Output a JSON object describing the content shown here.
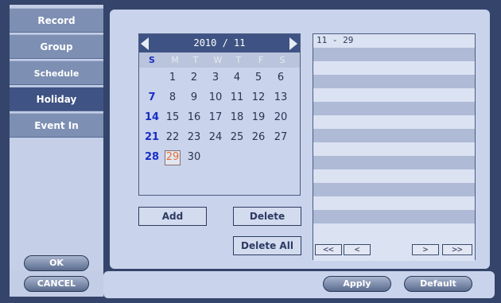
{
  "sidebar": {
    "items": [
      {
        "label": "Record"
      },
      {
        "label": "Group"
      },
      {
        "label": "Schedule"
      },
      {
        "label": "Holiday"
      },
      {
        "label": "Event In"
      }
    ],
    "active_index": 3
  },
  "buttons": {
    "ok": "OK",
    "cancel": "CANCEL",
    "apply": "Apply",
    "default": "Default",
    "add": "Add",
    "delete": "Delete",
    "delete_all": "Delete All"
  },
  "calendar": {
    "header": "2010 / 11",
    "weekdays": [
      "S",
      "M",
      "T",
      "W",
      "T",
      "F",
      "S"
    ],
    "selected_day": "29"
  },
  "holiday_list": {
    "entries": [
      "11 - 29"
    ]
  },
  "list_nav": {
    "first": "<<",
    "prev": "<",
    "next": ">",
    "last": ">>"
  }
}
